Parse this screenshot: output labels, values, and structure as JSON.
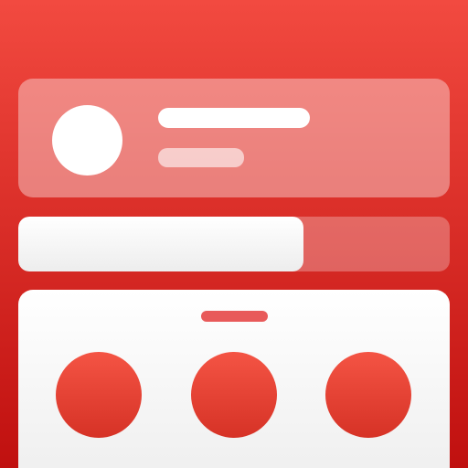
{
  "theme": {
    "accent": "#e53935",
    "surface": "#ffffff"
  },
  "profile_card": {
    "avatar_icon": "avatar-placeholder",
    "name_placeholder": "text-line",
    "subtitle_placeholder": "text-line"
  },
  "progress": {
    "fraction": 0.66
  },
  "bottom_sheet": {
    "handle": "drag-handle",
    "actions": [
      "action-button-1",
      "action-button-2",
      "action-button-3"
    ]
  }
}
